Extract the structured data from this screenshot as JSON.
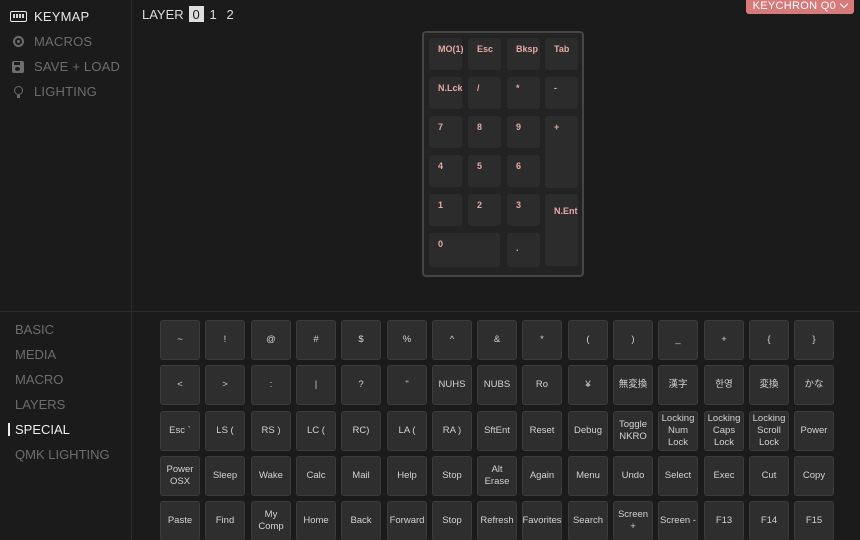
{
  "nav": [
    {
      "label": "KEYMAP",
      "icon": "keyboard-icon"
    },
    {
      "label": "MACROS",
      "icon": "macro-icon"
    },
    {
      "label": "SAVE + LOAD",
      "icon": "save-icon"
    },
    {
      "label": "LIGHTING",
      "icon": "lightbulb-icon"
    }
  ],
  "layer": {
    "label": "LAYER",
    "options": [
      "0",
      "1",
      "2"
    ],
    "selected": "0"
  },
  "device": {
    "name": "KEYCHRON Q0"
  },
  "keyboard_keys": [
    "MO(1)",
    "Esc",
    "Bksp",
    "Tab",
    "N.Lck",
    "/",
    "*",
    "-",
    "7",
    "8",
    "9",
    "+",
    "4",
    "5",
    "6",
    "1",
    "2",
    "3",
    "N.Ent",
    "0",
    "."
  ],
  "categories": [
    "BASIC",
    "MEDIA",
    "MACRO",
    "LAYERS",
    "SPECIAL",
    "QMK LIGHTING"
  ],
  "active_category": "SPECIAL",
  "keycodes": [
    [
      "~",
      "!",
      "@",
      "#",
      "$",
      "%",
      "^",
      "&",
      "*",
      "(",
      ")",
      "_",
      "+",
      "{",
      "}"
    ],
    [
      "<",
      ">",
      ":",
      "|",
      "?",
      "\"",
      "NUHS",
      "NUBS",
      "Ro",
      "¥",
      "無変換",
      "漢字",
      "한영",
      "変換",
      "かな"
    ],
    [
      "Esc `",
      "LS (",
      "RS )",
      "LC (",
      "RC)",
      "LA (",
      "RA )",
      "SftEnt",
      "Reset",
      "Debug",
      "Toggle\nNKRO",
      "Locking\nNum\nLock",
      "Locking\nCaps\nLock",
      "Locking\nScroll\nLock",
      "Power"
    ],
    [
      "Power\nOSX",
      "Sleep",
      "Wake",
      "Calc",
      "Mail",
      "Help",
      "Stop",
      "Alt\nErase",
      "Again",
      "Menu",
      "Undo",
      "Select",
      "Exec",
      "Cut",
      "Copy"
    ],
    [
      "Paste",
      "Find",
      "My\nComp",
      "Home",
      "Back",
      "Forward",
      "Stop",
      "Refresh",
      "Favorites",
      "Search",
      "Screen +",
      "Screen -",
      "F13",
      "F14",
      "F15"
    ]
  ],
  "colors": {
    "accent": "#d67a7a",
    "legend": "#e6a9a4",
    "background": "#1b1b1b"
  }
}
